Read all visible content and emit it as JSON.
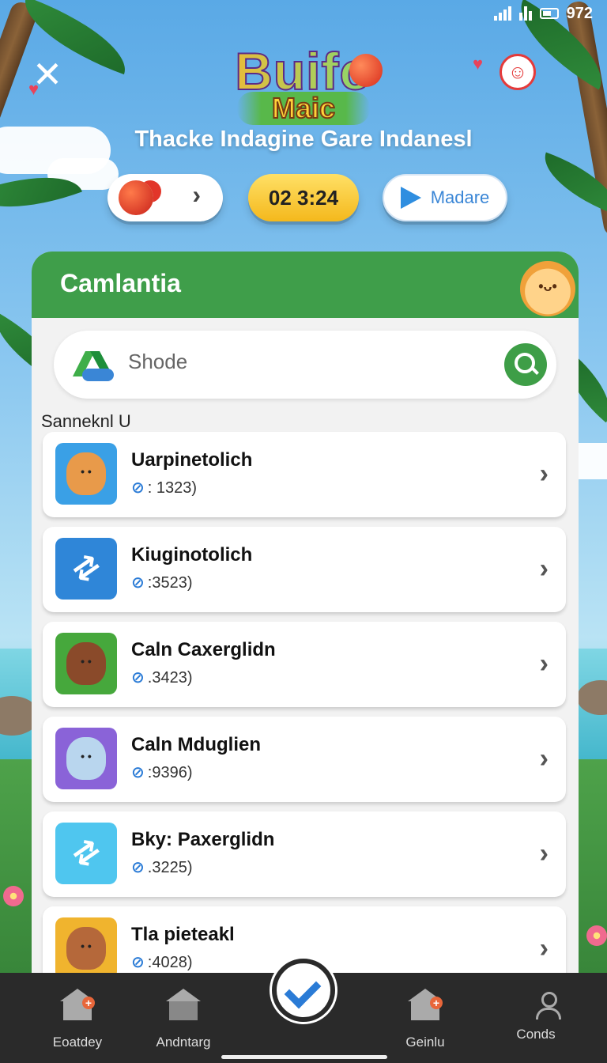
{
  "status_bar": {
    "time": "972"
  },
  "header": {
    "logo_line1": "Buifo",
    "logo_line2": "Maic",
    "tagline": "Thacke Indagine Gare Indanesl"
  },
  "pills": {
    "score": "02 3:24",
    "video_label": "Madare"
  },
  "card": {
    "title": "Camlantia",
    "search": {
      "placeholder": "Shode"
    },
    "section_label": "Sanneknl U",
    "items": [
      {
        "title": "Uarpinetolich",
        "sub": ": 1323)",
        "thumb": "fox-character",
        "bg": "#3aa0e6"
      },
      {
        "title": "Kiuginotolich",
        "sub": ":3523)",
        "thumb": "sync-arrows",
        "bg": "#2f86d8"
      },
      {
        "title": "Caln Caxerglidn",
        "sub": ".3423)",
        "thumb": "bear-character",
        "bg": "#46a83c"
      },
      {
        "title": "Caln Mduglien",
        "sub": ":9396)",
        "thumb": "rabbit-character",
        "bg": "#8a63d8"
      },
      {
        "title": "Bky: Paxerglidn",
        "sub": ".3225)",
        "thumb": "sync-arrows",
        "bg": "#4fc6ef"
      },
      {
        "title": "Tla pieteakl",
        "sub": ":4028)",
        "thumb": "kangaroo-character",
        "bg": "#f0b42e"
      }
    ]
  },
  "bottom_nav": {
    "items": [
      {
        "label": "Eoatdey",
        "icon": "home-plus-icon"
      },
      {
        "label": "Andntarg",
        "icon": "home-outline-icon"
      },
      {
        "label": "Geinlu",
        "icon": "home-plus-icon"
      },
      {
        "label": "Conds",
        "icon": "person-icon"
      }
    ]
  },
  "colors": {
    "accent_green": "#3f9e4a",
    "link_blue": "#2a7bd6",
    "score_yellow": "#f4b81c"
  }
}
